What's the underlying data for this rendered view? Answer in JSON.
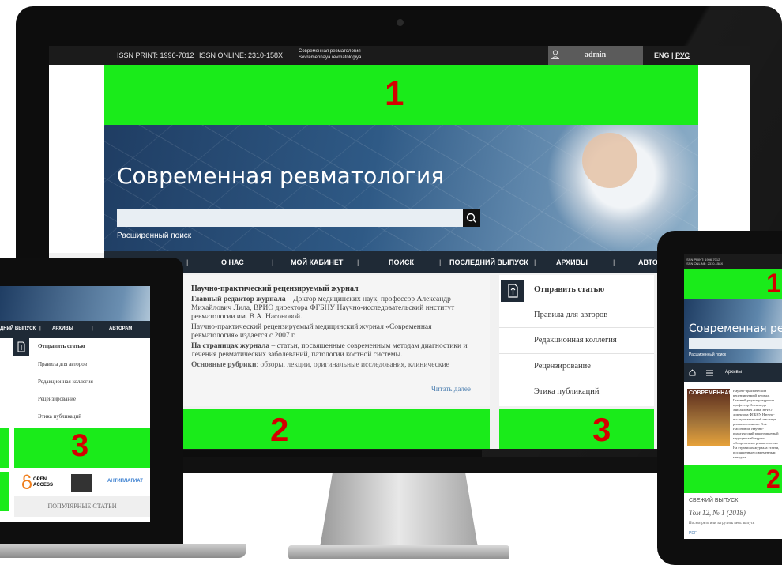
{
  "monitor": {
    "topbar": {
      "issn_print": "ISSN PRINT: 1996-7012",
      "issn_online": "ISSN ONLINE: 2310-158X",
      "journal_ru": "Современная ревматология",
      "journal_lat": "Sovremennaya revmatologiya",
      "user": "admin",
      "lang_eng": "ENG",
      "lang_sep": "|",
      "lang_rus": "РУС"
    },
    "zone1": "1",
    "hero": {
      "title": "Современная ревматология",
      "adv_search": "Расширенный поиск"
    },
    "nav": [
      "О НАС",
      "МОЙ КАБИНЕТ",
      "ПОИСК",
      "ПОСЛЕДНИЙ ВЫПУСК",
      "АРХИВЫ",
      "АВТО"
    ],
    "about": {
      "heading": "Научно-практический рецензируемый журнал",
      "p1_bold": "Главный редактор журнала",
      "p1": " – Доктор медицинских наук, профессор Александр Михайлович Лила, ВРИО директора ФГБНУ Научно-исследовательский институт ревматологии им. В.А. Насоновой.",
      "p2": "Научно-практический рецензируемый медицинский журнал «Современная ревматология» издается с 2007 г.",
      "p3_bold": "На страницах журнала",
      "p3": " – статьи, посвященные современным методам диагностики и лечения ревматических заболеваний, патологии костной системы.",
      "p4_bold": "Основные рубрики",
      "p4": ": обзоры, лекции, оригинальные исследования, клинические",
      "read_more": "Читать далее"
    },
    "zone2": "2",
    "menu": [
      "Отправить статью",
      "Правила для авторов",
      "Редакционная коллегия",
      "Рецензирование",
      "Этика публикаций"
    ],
    "zone3": "3"
  },
  "laptop": {
    "nav": [
      "ДНИЙ ВЫПУСК",
      "АРХИВЫ",
      "АВТОРАМ"
    ],
    "menu": [
      "Отправить статью",
      "Правила для авторов",
      "Редакционная коллегия",
      "Рецензирование",
      "Этика публикаций"
    ],
    "zone3": "3",
    "logos": [
      "OPEN ACCESS",
      "АНТИПЛАГИАТ"
    ],
    "popular": "ПОПУЛЯРНЫЕ СТАТЬИ"
  },
  "tablet": {
    "zone1": "1",
    "title": "Современная ревма",
    "adv_search": "Расширенный поиск",
    "nav_item": "Архивы",
    "cover_title": "СОВРЕМЕННАЯ",
    "text": "Научно-практический рецензируемый журнал. Главный редактор журнала профессор Александр Михайлович Лила, ВРИО директора ФГБНУ Научно-исследовательский институт ревматологии им. В.А. Насоновой. Научно-практический рецензируемый медицинский журнал «Современная ревматология» На страницах журнала статьи, посвященные современным методам",
    "zone2": "2",
    "fresh": "СВЕЖИЙ ВЫПУСК",
    "volume": "Том 12, № 1 (2018)",
    "view": "Посмотреть или загрузить весь выпуск",
    "pdf": "PDF"
  },
  "colors": {
    "green": "#1aeb1a",
    "zone_number": "#d40000",
    "nav_bg": "#1f2a36",
    "topbar_bg": "#1b1b1b",
    "link": "#4d7fb0"
  }
}
